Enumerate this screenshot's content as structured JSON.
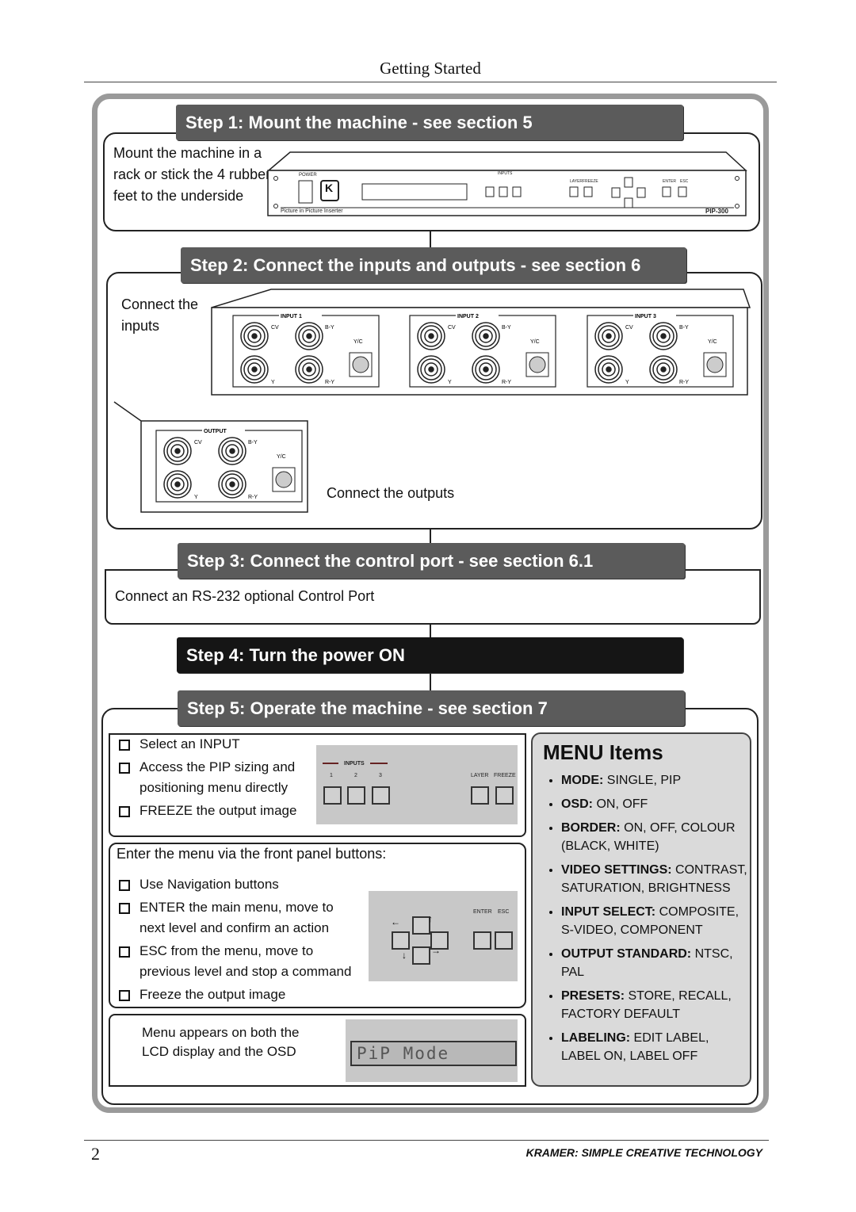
{
  "header": {
    "title": "Getting Started"
  },
  "steps": [
    {
      "title": "Step 1: Mount the machine - see section 5",
      "text": "Mount the machine in  a rack or stick the 4 rubber feet to the underside"
    },
    {
      "title": "Step 2: Connect the inputs and outputs - see section 6",
      "inputs_text": "Connect the inputs",
      "outputs_text": "Connect the outputs"
    },
    {
      "title": "Step 3: Connect the control port - see section 6.1",
      "text": "Connect an RS-232 optional Control Port"
    },
    {
      "title": "Step 4: Turn the power ON"
    },
    {
      "title": "Step 5: Operate the machine - see section 7"
    }
  ],
  "device": {
    "power": "POWER",
    "inputs": "INPUTS",
    "nums": [
      "1",
      "2",
      "3"
    ],
    "layer": "LAYER",
    "freeze": "FREEZE",
    "enter": "ENTER",
    "esc": "ESC",
    "model": "PIP-300",
    "subtitle": "Picture in Picture Inserter",
    "logo": "K"
  },
  "rear": {
    "input_labels": [
      "INPUT 1",
      "INPUT 2",
      "INPUT 3"
    ],
    "output_label": "OUTPUT",
    "cv": "CV",
    "by": "B-Y",
    "yc": "Y/C",
    "y": "Y",
    "ry": "R-Y"
  },
  "step5": {
    "box1": [
      "Select an INPUT",
      "Access the PIP sizing and positioning menu directly",
      "FREEZE the output image"
    ],
    "box2_title": "Enter the menu via the front panel buttons:",
    "box2": [
      "Use Navigation buttons",
      "ENTER the main menu, move to next level and confirm an action",
      "ESC from the menu, move to previous level and stop a command",
      "Freeze the output image"
    ],
    "box3": "Menu appears on both the LCD display and the OSD",
    "lcd": "PiP Mode"
  },
  "menu": {
    "title": "MENU Items",
    "items": [
      {
        "key": "MODE:",
        "val": " SINGLE, PIP"
      },
      {
        "key": "OSD:",
        "val": " ON, OFF"
      },
      {
        "key": "BORDER:",
        "val": " ON, OFF, COLOUR (BLACK, WHITE)"
      },
      {
        "key": "VIDEO SETTINGS:",
        "val": " CONTRAST,  SATURATION, BRIGHTNESS"
      },
      {
        "key": "INPUT SELECT:",
        "val": " COMPOSITE, S-VIDEO, COMPONENT"
      },
      {
        "key": "OUTPUT STANDARD:",
        "val": " NTSC, PAL"
      },
      {
        "key": "PRESETS:",
        "val": " STORE, RECALL, FACTORY DEFAULT"
      },
      {
        "key": "LABELING:",
        "val": " EDIT LABEL, LABEL ON, LABEL OFF"
      }
    ]
  },
  "footer": {
    "page": "2",
    "brand": "KRAMER:  SIMPLE CREATIVE TECHNOLOGY"
  },
  "colors": {
    "bar": "#5b5b5b",
    "bar_power": "#151515",
    "panel": "#c8c8c8",
    "menu_bg": "#dadada"
  }
}
